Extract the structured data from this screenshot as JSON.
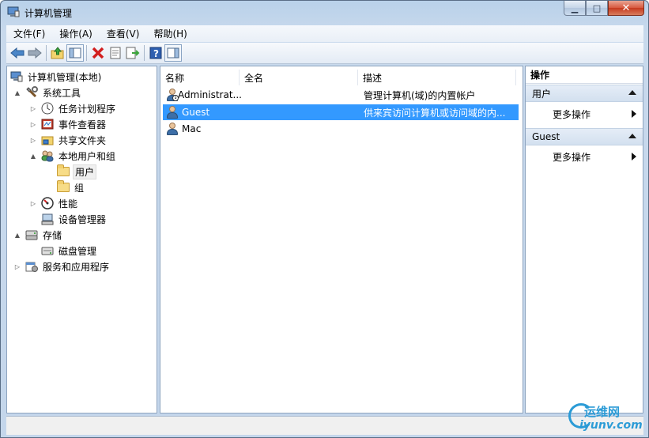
{
  "window": {
    "title": "计算机管理",
    "controls": {
      "minimize": "▁",
      "maximize": "□",
      "close": "✕"
    }
  },
  "menubar": {
    "items": [
      "文件(F)",
      "操作(A)",
      "查看(V)",
      "帮助(H)"
    ]
  },
  "toolbar": {
    "icons": [
      "back-arrow-icon",
      "forward-arrow-icon",
      "up-folder-icon",
      "show-hide-tree-icon",
      "delete-icon",
      "properties-icon",
      "export-list-icon",
      "help-icon",
      "show-hide-action-pane-icon"
    ]
  },
  "tree": {
    "items": [
      {
        "label": "计算机管理(本地)",
        "icon": "computer-management-icon",
        "level": 0,
        "expander": ""
      },
      {
        "label": "系统工具",
        "icon": "system-tools-icon",
        "level": 1,
        "expander": "▲"
      },
      {
        "label": "任务计划程序",
        "icon": "clock-icon",
        "level": 2,
        "expander": "▷"
      },
      {
        "label": "事件查看器",
        "icon": "event-viewer-icon",
        "level": 2,
        "expander": "▷"
      },
      {
        "label": "共享文件夹",
        "icon": "shared-folder-icon",
        "level": 2,
        "expander": "▷"
      },
      {
        "label": "本地用户和组",
        "icon": "local-users-groups-icon",
        "level": 2,
        "expander": "▲"
      },
      {
        "label": "用户",
        "icon": "folder-icon",
        "level": 3,
        "expander": "",
        "selected": true
      },
      {
        "label": "组",
        "icon": "folder-icon",
        "level": 3,
        "expander": ""
      },
      {
        "label": "性能",
        "icon": "performance-icon",
        "level": 2,
        "expander": "▷"
      },
      {
        "label": "设备管理器",
        "icon": "device-manager-icon",
        "level": 2,
        "expander": ""
      },
      {
        "label": "存储",
        "icon": "storage-icon",
        "level": 1,
        "expander": "▲"
      },
      {
        "label": "磁盘管理",
        "icon": "disk-management-icon",
        "level": 2,
        "expander": ""
      },
      {
        "label": "服务和应用程序",
        "icon": "services-apps-icon",
        "level": 1,
        "expander": "▷"
      }
    ]
  },
  "list": {
    "columns": [
      "名称",
      "全名",
      "描述"
    ],
    "rows": [
      {
        "name": "Administrat...",
        "full_name": "",
        "description": "管理计算机(域)的内置帐户",
        "icon": "user-icon"
      },
      {
        "name": "Guest",
        "full_name": "",
        "description": "供来宾访问计算机或访问域的内...",
        "icon": "user-icon",
        "selected": true
      },
      {
        "name": "Mac",
        "full_name": "",
        "description": "",
        "icon": "user-icon"
      }
    ]
  },
  "actions": {
    "title": "操作",
    "groups": [
      {
        "label": "用户",
        "item": "更多操作"
      },
      {
        "label": "Guest",
        "item": "更多操作"
      }
    ]
  },
  "watermark": {
    "line1": "运维网",
    "line2": "iyunv.com"
  },
  "colors": {
    "selection": "#3399ff",
    "frame": "#b9d1ea",
    "close": "#c63a1f"
  }
}
